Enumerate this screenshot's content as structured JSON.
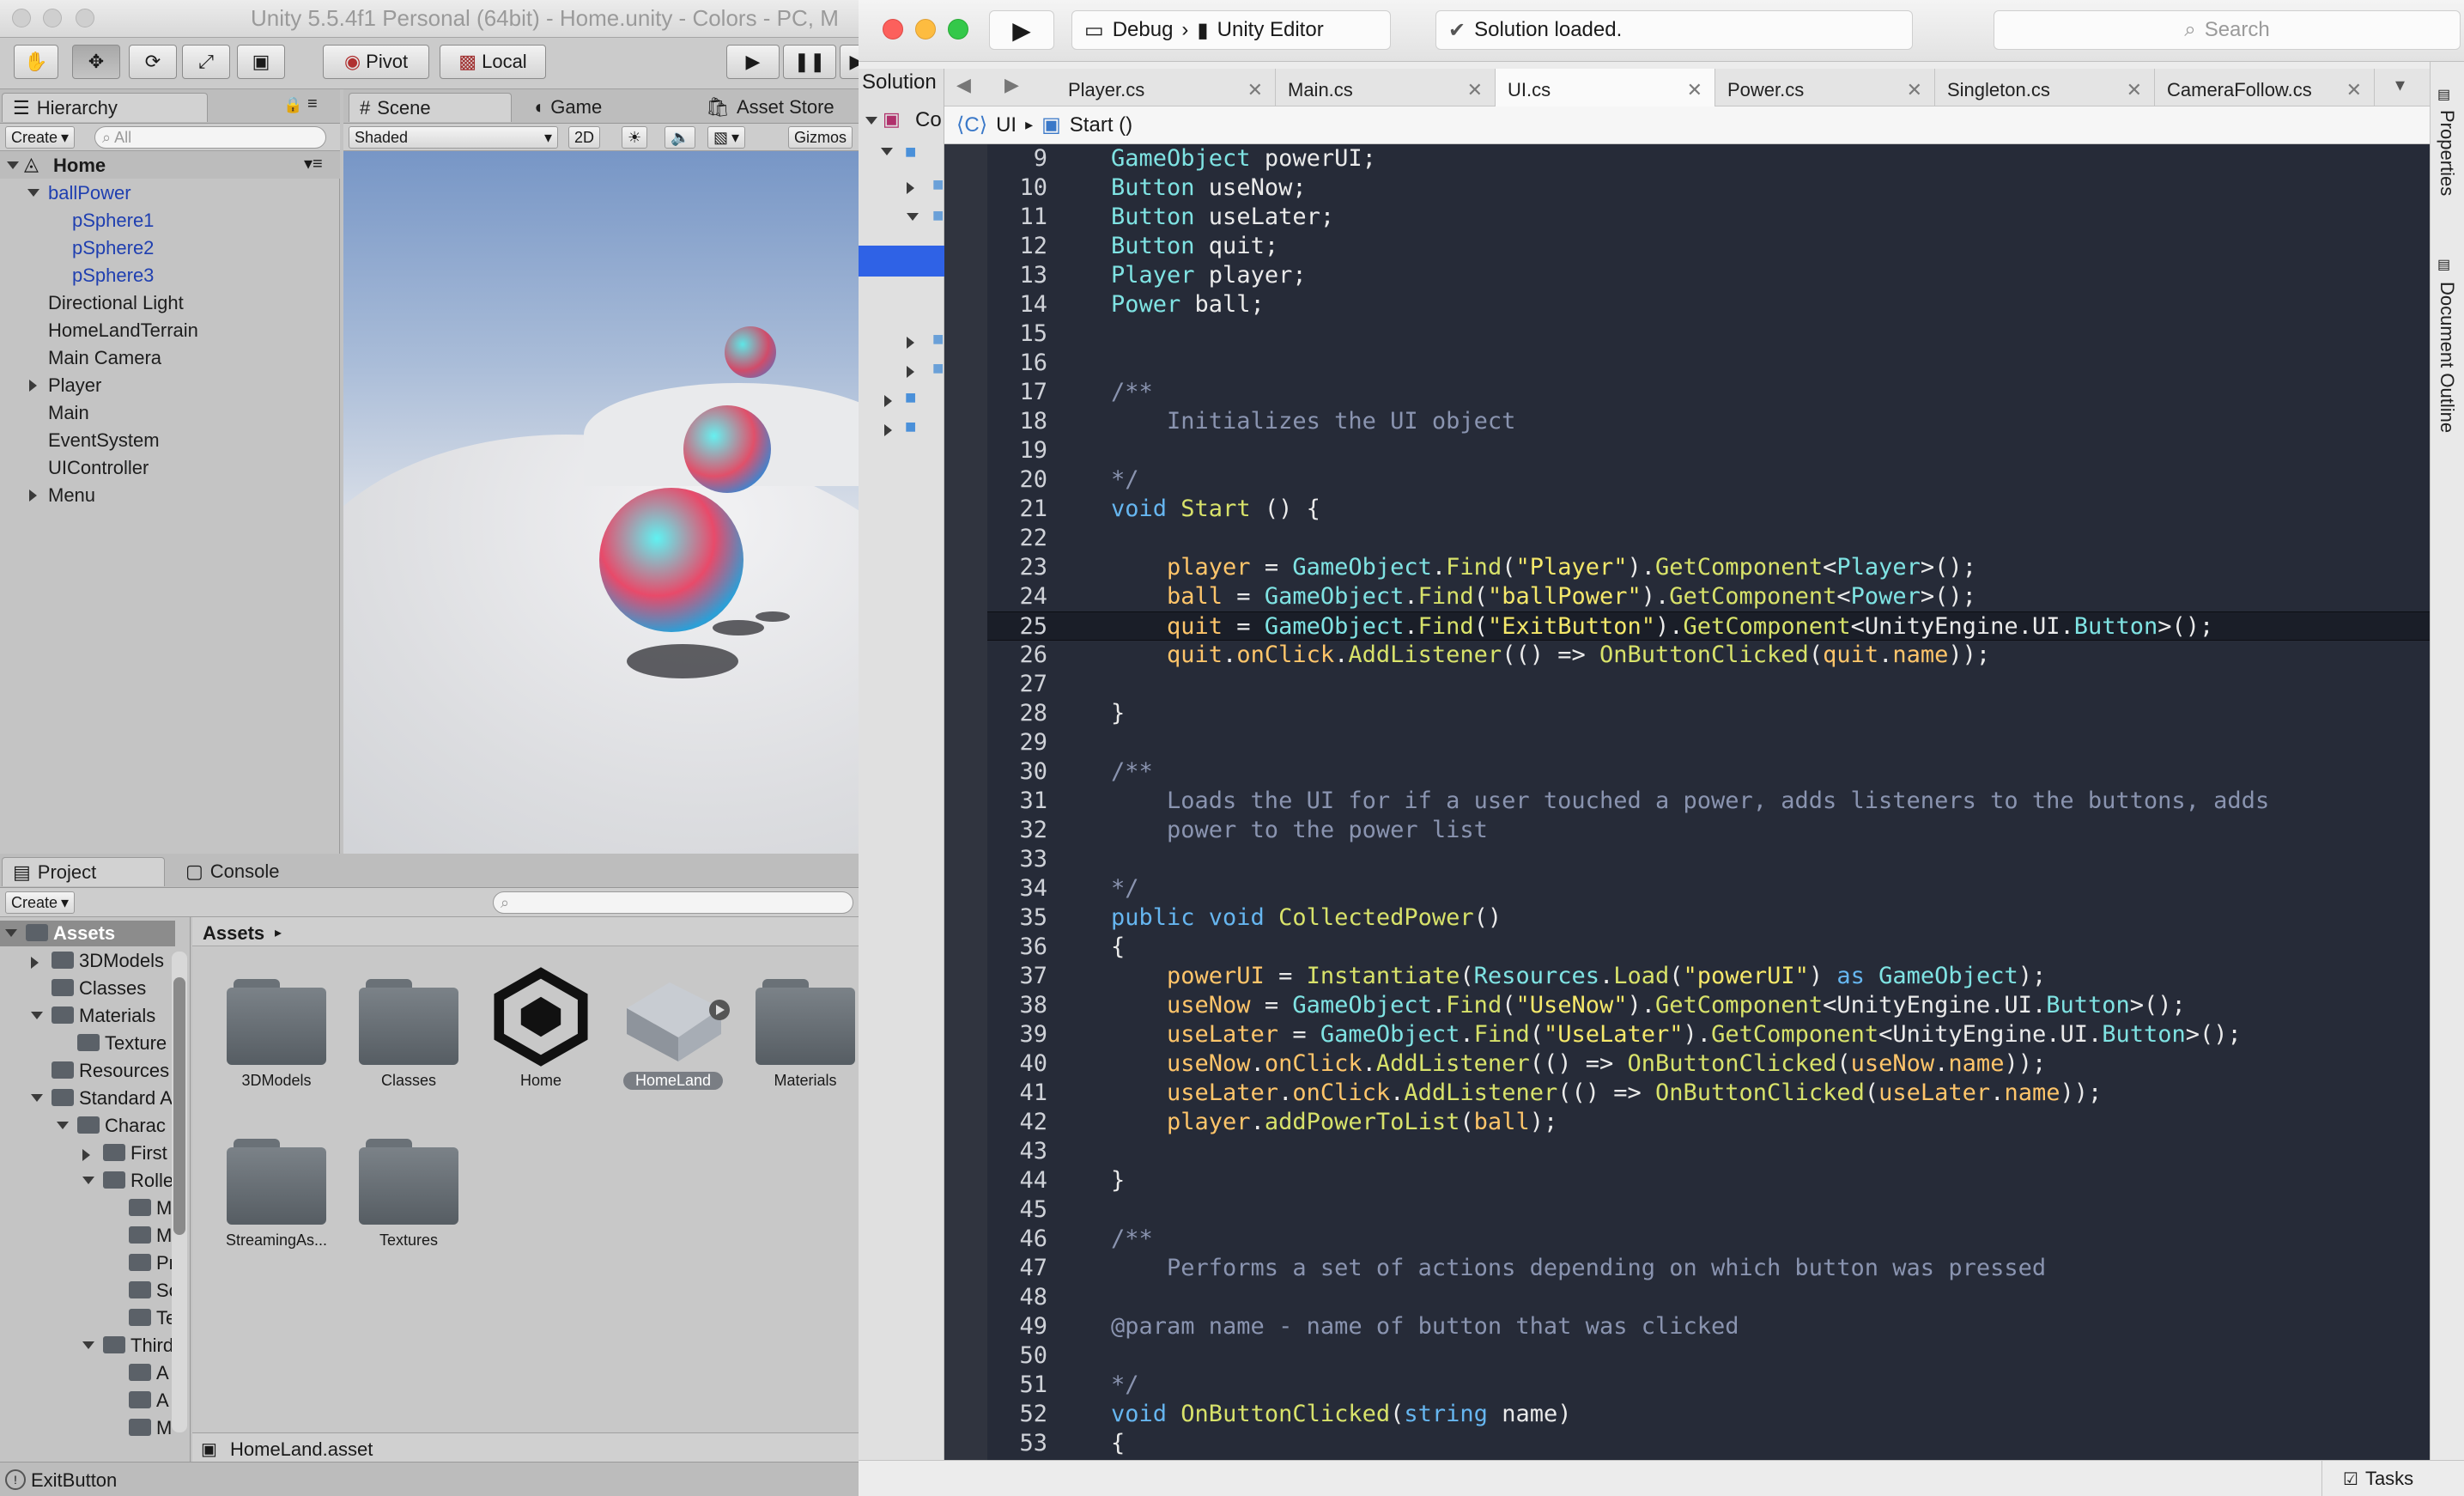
{
  "unity": {
    "title": "Unity 5.5.4f1 Personal (64bit) - Home.unity - Colors - PC, M",
    "toolbar": {
      "pivot": "Pivot",
      "local": "Local"
    },
    "hierarchy": {
      "tab": "Hierarchy",
      "create": "Create",
      "search_placeholder": "All",
      "scene": "Home",
      "items": [
        "ballPower",
        "pSphere1",
        "pSphere2",
        "pSphere3",
        "Directional Light",
        "HomeLandTerrain",
        "Main Camera",
        "Player",
        "Main",
        "EventSystem",
        "UIController",
        "Menu"
      ]
    },
    "scene_tabs": {
      "scene": "Scene",
      "game": "Game",
      "asset_store": "Asset Store"
    },
    "scene_toolbar": {
      "shading": "Shaded",
      "mode2d": "2D",
      "gizmos": "Gizmos"
    },
    "project": {
      "tab": "Project",
      "console_tab": "Console",
      "create": "Create",
      "tree": [
        "Assets",
        "3DModels",
        "Classes",
        "Materials",
        "Texture",
        "Resources",
        "Standard A",
        "Charac",
        "First",
        "Rolle",
        "M",
        "M",
        "Pr",
        "Sc",
        "Te",
        "Third",
        "A",
        "A",
        "M"
      ],
      "breadcrumb": "Assets",
      "assets": [
        "3DModels",
        "Classes",
        "Home",
        "HomeLand",
        "Materials",
        "StreamingAs...",
        "Textures"
      ],
      "selected_file": "HomeLand.asset"
    },
    "status": "ExitButton"
  },
  "vs": {
    "config": "Debug",
    "target": "Unity Editor",
    "status": "Solution loaded.",
    "search_placeholder": "Search",
    "solution_label": "Solution",
    "solution_sub": "Co",
    "tabs": [
      "Player.cs",
      "Main.cs",
      "UI.cs",
      "Power.cs",
      "Singleton.cs",
      "CameraFollow.cs"
    ],
    "active_tab": "UI.cs",
    "path": {
      "class": "UI",
      "method": "Start ()"
    },
    "right_panels": [
      "Properties",
      "Document Outline"
    ],
    "bottom_tasks": "Tasks",
    "current_line": 25,
    "code": [
      {
        "n": "9",
        "t": [
          [
            "ty",
            "GameObject"
          ],
          [
            "pl",
            " powerUI;"
          ]
        ]
      },
      {
        "n": "10",
        "t": [
          [
            "ty",
            "Button"
          ],
          [
            "pl",
            " useNow;"
          ]
        ]
      },
      {
        "n": "11",
        "t": [
          [
            "ty",
            "Button"
          ],
          [
            "pl",
            " useLater;"
          ]
        ]
      },
      {
        "n": "12",
        "t": [
          [
            "ty",
            "Button"
          ],
          [
            "pl",
            " quit;"
          ]
        ]
      },
      {
        "n": "13",
        "t": [
          [
            "ty",
            "Player"
          ],
          [
            "pl",
            " player;"
          ]
        ]
      },
      {
        "n": "14",
        "t": [
          [
            "ty",
            "Power"
          ],
          [
            "pl",
            " ball;"
          ]
        ]
      },
      {
        "n": "15",
        "t": []
      },
      {
        "n": "16",
        "t": []
      },
      {
        "n": "17",
        "t": [
          [
            "cm",
            "/**"
          ]
        ]
      },
      {
        "n": "18",
        "t": [
          [
            "cm",
            "    Initializes the UI object"
          ]
        ]
      },
      {
        "n": "19",
        "t": []
      },
      {
        "n": "20",
        "t": [
          [
            "cm",
            "*/"
          ]
        ]
      },
      {
        "n": "21",
        "t": [
          [
            "kw",
            "void"
          ],
          [
            "pl",
            " "
          ],
          [
            "fn",
            "Start"
          ],
          [
            "pl",
            " () {"
          ]
        ]
      },
      {
        "n": "22",
        "t": []
      },
      {
        "n": "23",
        "t": [
          [
            "mem",
            "    player"
          ],
          [
            "pl",
            " = "
          ],
          [
            "ty",
            "GameObject"
          ],
          [
            "pl",
            "."
          ],
          [
            "fn",
            "Find"
          ],
          [
            "pl",
            "("
          ],
          [
            "str",
            "\"Player\""
          ],
          [
            "pl",
            ")."
          ],
          [
            "fn",
            "GetComponent"
          ],
          [
            "pl",
            "<"
          ],
          [
            "ty",
            "Player"
          ],
          [
            "pl",
            ">();"
          ]
        ]
      },
      {
        "n": "24",
        "t": [
          [
            "mem",
            "    ball"
          ],
          [
            "pl",
            " = "
          ],
          [
            "ty",
            "GameObject"
          ],
          [
            "pl",
            "."
          ],
          [
            "fn",
            "Find"
          ],
          [
            "pl",
            "("
          ],
          [
            "str",
            "\"ballPower\""
          ],
          [
            "pl",
            ")."
          ],
          [
            "fn",
            "GetComponent"
          ],
          [
            "pl",
            "<"
          ],
          [
            "ty",
            "Power"
          ],
          [
            "pl",
            ">();"
          ]
        ]
      },
      {
        "n": "25",
        "t": [
          [
            "mem",
            "    quit"
          ],
          [
            "pl",
            " = "
          ],
          [
            "ty",
            "GameObject"
          ],
          [
            "pl",
            "."
          ],
          [
            "fn",
            "Find"
          ],
          [
            "pl",
            "("
          ],
          [
            "str",
            "\"ExitButton\""
          ],
          [
            "pl",
            ")."
          ],
          [
            "fn",
            "GetComponent"
          ],
          [
            "pl",
            "<UnityEngine.UI."
          ],
          [
            "ty",
            "Button"
          ],
          [
            "pl",
            ">();"
          ]
        ]
      },
      {
        "n": "26",
        "t": [
          [
            "mem",
            "    quit"
          ],
          [
            "pl",
            "."
          ],
          [
            "mem",
            "onClick"
          ],
          [
            "pl",
            "."
          ],
          [
            "fn",
            "AddListener"
          ],
          [
            "pl",
            "(() => "
          ],
          [
            "fn",
            "OnButtonClicked"
          ],
          [
            "pl",
            "("
          ],
          [
            "mem",
            "quit"
          ],
          [
            "pl",
            "."
          ],
          [
            "mem",
            "name"
          ],
          [
            "pl",
            "));"
          ]
        ]
      },
      {
        "n": "27",
        "t": []
      },
      {
        "n": "28",
        "t": [
          [
            "pl",
            "}"
          ]
        ]
      },
      {
        "n": "29",
        "t": []
      },
      {
        "n": "30",
        "t": [
          [
            "cm",
            "/**"
          ]
        ]
      },
      {
        "n": "31",
        "t": [
          [
            "cm",
            "    Loads the UI for if a user touched a power, adds listeners to the buttons, adds"
          ]
        ]
      },
      {
        "n": "32",
        "t": [
          [
            "cm",
            "    power to the power list"
          ]
        ]
      },
      {
        "n": "33",
        "t": []
      },
      {
        "n": "34",
        "t": [
          [
            "cm",
            "*/"
          ]
        ]
      },
      {
        "n": "35",
        "t": [
          [
            "kw",
            "public void"
          ],
          [
            "pl",
            " "
          ],
          [
            "fn",
            "CollectedPower"
          ],
          [
            "pl",
            "()"
          ]
        ]
      },
      {
        "n": "36",
        "t": [
          [
            "pl",
            "{"
          ]
        ]
      },
      {
        "n": "37",
        "t": [
          [
            "mem",
            "    powerUI"
          ],
          [
            "pl",
            " = "
          ],
          [
            "fn",
            "Instantiate"
          ],
          [
            "pl",
            "("
          ],
          [
            "ty",
            "Resources"
          ],
          [
            "pl",
            "."
          ],
          [
            "fn",
            "Load"
          ],
          [
            "pl",
            "("
          ],
          [
            "str",
            "\"powerUI\""
          ],
          [
            "pl",
            ") "
          ],
          [
            "kw",
            "as"
          ],
          [
            "pl",
            " "
          ],
          [
            "ty",
            "GameObject"
          ],
          [
            "pl",
            ");"
          ]
        ]
      },
      {
        "n": "38",
        "t": [
          [
            "mem",
            "    useNow"
          ],
          [
            "pl",
            " = "
          ],
          [
            "ty",
            "GameObject"
          ],
          [
            "pl",
            "."
          ],
          [
            "fn",
            "Find"
          ],
          [
            "pl",
            "("
          ],
          [
            "str",
            "\"UseNow\""
          ],
          [
            "pl",
            ")."
          ],
          [
            "fn",
            "GetComponent"
          ],
          [
            "pl",
            "<UnityEngine.UI."
          ],
          [
            "ty",
            "Button"
          ],
          [
            "pl",
            ">();"
          ]
        ]
      },
      {
        "n": "39",
        "t": [
          [
            "mem",
            "    useLater"
          ],
          [
            "pl",
            " = "
          ],
          [
            "ty",
            "GameObject"
          ],
          [
            "pl",
            "."
          ],
          [
            "fn",
            "Find"
          ],
          [
            "pl",
            "("
          ],
          [
            "str",
            "\"UseLater\""
          ],
          [
            "pl",
            ")."
          ],
          [
            "fn",
            "GetComponent"
          ],
          [
            "pl",
            "<UnityEngine.UI."
          ],
          [
            "ty",
            "Button"
          ],
          [
            "pl",
            ">();"
          ]
        ]
      },
      {
        "n": "40",
        "t": [
          [
            "mem",
            "    useNow"
          ],
          [
            "pl",
            "."
          ],
          [
            "mem",
            "onClick"
          ],
          [
            "pl",
            "."
          ],
          [
            "fn",
            "AddListener"
          ],
          [
            "pl",
            "(() => "
          ],
          [
            "fn",
            "OnButtonClicked"
          ],
          [
            "pl",
            "("
          ],
          [
            "mem",
            "useNow"
          ],
          [
            "pl",
            "."
          ],
          [
            "mem",
            "name"
          ],
          [
            "pl",
            "));"
          ]
        ]
      },
      {
        "n": "41",
        "t": [
          [
            "mem",
            "    useLater"
          ],
          [
            "pl",
            "."
          ],
          [
            "mem",
            "onClick"
          ],
          [
            "pl",
            "."
          ],
          [
            "fn",
            "AddListener"
          ],
          [
            "pl",
            "(() => "
          ],
          [
            "fn",
            "OnButtonClicked"
          ],
          [
            "pl",
            "("
          ],
          [
            "mem",
            "useLater"
          ],
          [
            "pl",
            "."
          ],
          [
            "mem",
            "name"
          ],
          [
            "pl",
            "));"
          ]
        ]
      },
      {
        "n": "42",
        "t": [
          [
            "mem",
            "    player"
          ],
          [
            "pl",
            "."
          ],
          [
            "fn",
            "addPowerToList"
          ],
          [
            "pl",
            "("
          ],
          [
            "mem",
            "ball"
          ],
          [
            "pl",
            ");"
          ]
        ]
      },
      {
        "n": "43",
        "t": []
      },
      {
        "n": "44",
        "t": [
          [
            "pl",
            "}"
          ]
        ]
      },
      {
        "n": "45",
        "t": []
      },
      {
        "n": "46",
        "t": [
          [
            "cm",
            "/**"
          ]
        ]
      },
      {
        "n": "47",
        "t": [
          [
            "cm",
            "    Performs a set of actions depending on which button was pressed"
          ]
        ]
      },
      {
        "n": "48",
        "t": []
      },
      {
        "n": "49",
        "t": [
          [
            "cm",
            "@param name - name of button that was clicked"
          ]
        ]
      },
      {
        "n": "50",
        "t": []
      },
      {
        "n": "51",
        "t": [
          [
            "cm",
            "*/"
          ]
        ]
      },
      {
        "n": "52",
        "t": [
          [
            "kw",
            "void"
          ],
          [
            "pl",
            " "
          ],
          [
            "fn",
            "OnButtonClicked"
          ],
          [
            "pl",
            "("
          ],
          [
            "kw",
            "string"
          ],
          [
            "pl",
            " name)"
          ]
        ]
      },
      {
        "n": "53",
        "t": [
          [
            "pl",
            "{"
          ]
        ]
      }
    ]
  }
}
